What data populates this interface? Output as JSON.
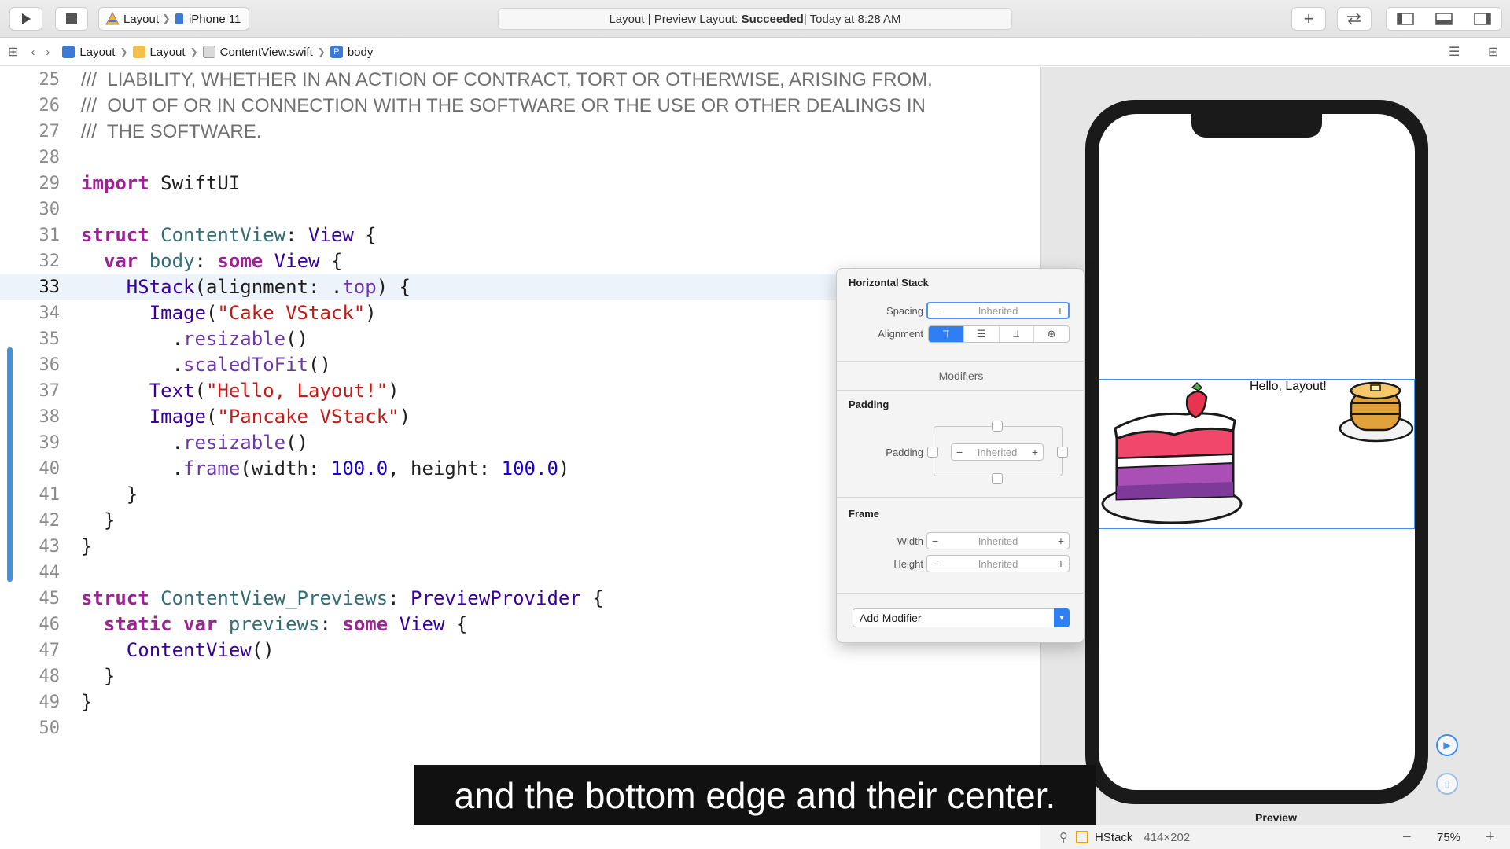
{
  "toolbar": {
    "scheme_project": "Layout",
    "scheme_device": "iPhone 11",
    "status_prefix": "Layout | Preview Layout: ",
    "status_result": "Succeeded",
    "status_suffix": " | Today at 8:28 AM"
  },
  "jumpbar": {
    "crumbs": [
      "Layout",
      "Layout",
      "ContentView.swift",
      "body"
    ]
  },
  "editor": {
    "line_numbers": [
      "25",
      "26",
      "27",
      "28",
      "29",
      "30",
      "31",
      "32",
      "33",
      "34",
      "35",
      "36",
      "37",
      "38",
      "39",
      "40",
      "41",
      "42",
      "43",
      "44",
      "45",
      "46",
      "47",
      "48",
      "49",
      "50"
    ],
    "comment_lines": [
      "LIABILITY, WHETHER IN AN ACTION OF CONTRACT, TORT OR OTHERWISE, ARISING FROM,",
      "OUT OF OR IN CONNECTION WITH THE SOFTWARE OR THE USE OR OTHER DEALINGS IN",
      "THE SOFTWARE."
    ],
    "comment_prefix": "///",
    "current_line": "33"
  },
  "inspector": {
    "title": "Horizontal Stack",
    "spacing_label": "Spacing",
    "alignment_label": "Alignment",
    "inherited": "Inherited",
    "modifiers_label": "Modifiers",
    "padding_section": "Padding",
    "padding_label": "Padding",
    "frame_section": "Frame",
    "width_label": "Width",
    "height_label": "Height",
    "add_modifier": "Add Modifier"
  },
  "preview": {
    "hello_text": "Hello, Layout!",
    "label": "Preview"
  },
  "bottombar": {
    "selection": "HStack",
    "size": "414×202",
    "zoom": "75%"
  },
  "subtitle": "and the bottom edge and their center.",
  "colors": {
    "accent": "#2f7ef3",
    "keyword": "#9b2393",
    "string": "#c41a16",
    "number": "#1c00cf"
  }
}
